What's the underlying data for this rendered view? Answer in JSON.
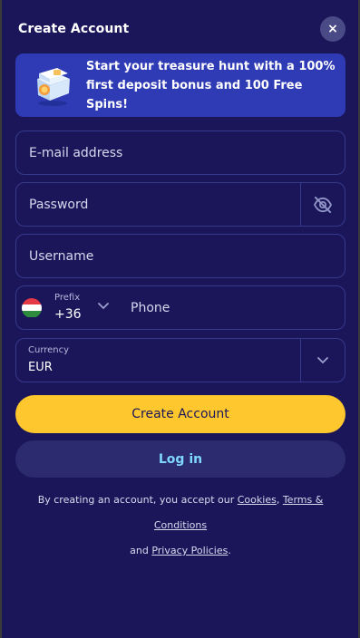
{
  "header": {
    "title": "Create Account",
    "close_glyph": "×"
  },
  "banner": {
    "icon": "treasure-chest-icon",
    "text": "Start your treasure hunt with a 100% first deposit bonus and 100 Free Spins!"
  },
  "form": {
    "email": {
      "placeholder": "E-mail address",
      "value": ""
    },
    "password": {
      "placeholder": "Password",
      "value": "",
      "toggle_icon": "eye-off-icon"
    },
    "username": {
      "placeholder": "Username",
      "value": ""
    },
    "phone": {
      "prefix_label": "Prefix",
      "prefix_value": "+36",
      "flag": "hungary-flag-icon",
      "placeholder": "Phone",
      "value": ""
    },
    "currency": {
      "label": "Currency",
      "value": "EUR"
    }
  },
  "actions": {
    "create_label": "Create Account",
    "login_label": "Log in"
  },
  "terms": {
    "prefix": "By creating an account, you accept our ",
    "cookies": "Cookies",
    "sep": ", ",
    "terms_link": "Terms & Conditions",
    "and": "and ",
    "privacy": "Privacy Policies",
    "suffix": "."
  },
  "colors": {
    "background": "#1a1659",
    "banner": "#2f3ab5",
    "primary_button": "#fec72e",
    "secondary_button": "#2c2b70",
    "link_accent": "#7fd7ff",
    "field_border": "#363a8c"
  }
}
